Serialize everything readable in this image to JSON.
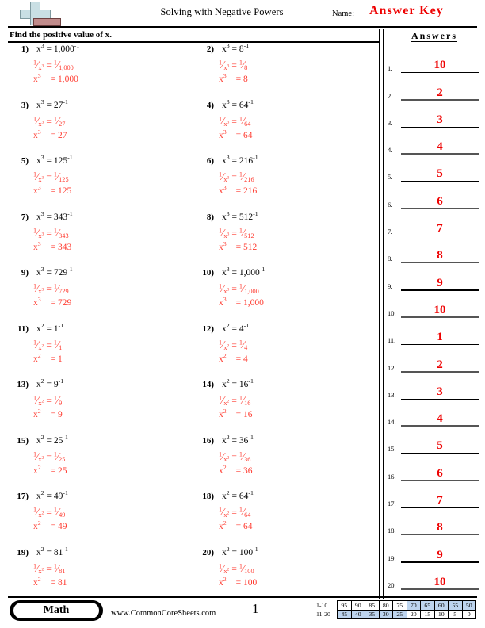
{
  "header": {
    "title": "Solving with Negative Powers",
    "name_label": "Name:",
    "answer_key": "Answer Key",
    "instruction": "Find the positive value of x.",
    "logo_icon": "plus-block-logo"
  },
  "answers_panel": {
    "heading": "Answers",
    "rows": [
      {
        "num": "1.",
        "value": "10"
      },
      {
        "num": "2.",
        "value": "2"
      },
      {
        "num": "3.",
        "value": "3"
      },
      {
        "num": "4.",
        "value": "4"
      },
      {
        "num": "5.",
        "value": "5"
      },
      {
        "num": "6.",
        "value": "6"
      },
      {
        "num": "7.",
        "value": "7"
      },
      {
        "num": "8.",
        "value": "8"
      },
      {
        "num": "9.",
        "value": "9"
      },
      {
        "num": "10.",
        "value": "10"
      },
      {
        "num": "11.",
        "value": "1"
      },
      {
        "num": "12.",
        "value": "2"
      },
      {
        "num": "13.",
        "value": "3"
      },
      {
        "num": "14.",
        "value": "4"
      },
      {
        "num": "15.",
        "value": "5"
      },
      {
        "num": "16.",
        "value": "6"
      },
      {
        "num": "17.",
        "value": "7"
      },
      {
        "num": "18.",
        "value": "8"
      },
      {
        "num": "19.",
        "value": "9"
      },
      {
        "num": "20.",
        "value": "10"
      }
    ]
  },
  "problems": [
    {
      "num": "1)",
      "power": "3",
      "base": "1,000",
      "step1_left": "1/x³",
      "step1_right": "1/1,000",
      "answer": "x³ = 1,000"
    },
    {
      "num": "2)",
      "power": "3",
      "base": "8",
      "step1_left": "1/x³",
      "step1_right": "1/8",
      "answer": "x³ = 8"
    },
    {
      "num": "3)",
      "power": "3",
      "base": "27",
      "step1_left": "1/x³",
      "step1_right": "1/27",
      "answer": "x³ = 27"
    },
    {
      "num": "4)",
      "power": "3",
      "base": "64",
      "step1_left": "1/x³",
      "step1_right": "1/64",
      "answer": "x³ = 64"
    },
    {
      "num": "5)",
      "power": "3",
      "base": "125",
      "step1_left": "1/x³",
      "step1_right": "1/125",
      "answer": "x³ = 125"
    },
    {
      "num": "6)",
      "power": "3",
      "base": "216",
      "step1_left": "1/x³",
      "step1_right": "1/216",
      "answer": "x³ = 216"
    },
    {
      "num": "7)",
      "power": "3",
      "base": "343",
      "step1_left": "1/x³",
      "step1_right": "1/343",
      "answer": "x³ = 343"
    },
    {
      "num": "8)",
      "power": "3",
      "base": "512",
      "step1_left": "1/x³",
      "step1_right": "1/512",
      "answer": "x³ = 512"
    },
    {
      "num": "9)",
      "power": "3",
      "base": "729",
      "step1_left": "1/x³",
      "step1_right": "1/729",
      "answer": "x³ = 729"
    },
    {
      "num": "10)",
      "power": "3",
      "base": "1,000",
      "step1_left": "1/x³",
      "step1_right": "1/1,000",
      "answer": "x³ = 1,000"
    },
    {
      "num": "11)",
      "power": "2",
      "base": "1",
      "step1_left": "1/x²",
      "step1_right": "1/1",
      "answer": "x² = 1"
    },
    {
      "num": "12)",
      "power": "2",
      "base": "4",
      "step1_left": "1/x²",
      "step1_right": "1/4",
      "answer": "x² = 4"
    },
    {
      "num": "13)",
      "power": "2",
      "base": "9",
      "step1_left": "1/x²",
      "step1_right": "1/9",
      "answer": "x² = 9"
    },
    {
      "num": "14)",
      "power": "2",
      "base": "16",
      "step1_left": "1/x²",
      "step1_right": "1/16",
      "answer": "x² = 16"
    },
    {
      "num": "15)",
      "power": "2",
      "base": "25",
      "step1_left": "1/x²",
      "step1_right": "1/25",
      "answer": "x² = 25"
    },
    {
      "num": "16)",
      "power": "2",
      "base": "36",
      "step1_left": "1/x²",
      "step1_right": "1/36",
      "answer": "x² = 36"
    },
    {
      "num": "17)",
      "power": "2",
      "base": "49",
      "step1_left": "1/x²",
      "step1_right": "1/49",
      "answer": "x² = 49"
    },
    {
      "num": "18)",
      "power": "2",
      "base": "64",
      "step1_left": "1/x²",
      "step1_right": "1/64",
      "answer": "x² = 64"
    },
    {
      "num": "19)",
      "power": "2",
      "base": "81",
      "step1_left": "1/x²",
      "step1_right": "1/81",
      "answer": "x² = 81"
    },
    {
      "num": "20)",
      "power": "2",
      "base": "100",
      "step1_left": "1/x²",
      "step1_right": "1/100",
      "answer": "x² = 100"
    }
  ],
  "footer": {
    "subject_badge": "Math",
    "site": "www.CommonCoreSheets.com",
    "page_number": "1",
    "score_table": {
      "row1_label": "1-10",
      "row2_label": "11-20",
      "row1": [
        "95",
        "90",
        "85",
        "80",
        "75",
        "70",
        "65",
        "60",
        "55",
        "50"
      ],
      "row2": [
        "45",
        "40",
        "35",
        "30",
        "25",
        "20",
        "15",
        "10",
        "5",
        "0"
      ],
      "row1_shaded": [
        false,
        false,
        false,
        false,
        false,
        true,
        true,
        true,
        true,
        true
      ],
      "row2_shaded": [
        true,
        true,
        true,
        true,
        true,
        false,
        false,
        false,
        false,
        false
      ]
    }
  },
  "colors": {
    "answer_red": "#ee0000",
    "work_red": "#ff3b30",
    "shade_blue": "#bdd4ee",
    "logo_blue": "#c9dfe4",
    "logo_red": "#c08b8b"
  }
}
